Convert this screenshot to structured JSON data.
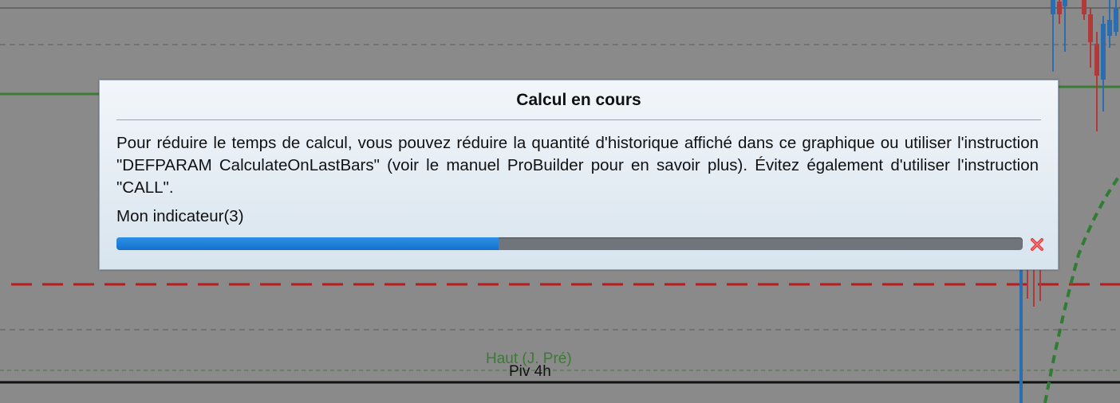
{
  "dialog": {
    "title": "Calcul en cours",
    "message": "Pour réduire le temps de calcul, vous pouvez réduire la quantité d'historique affiché dans ce graphique ou utiliser l'instruction \"DEFPARAM CalculateOnLastBars\" (voir le manuel ProBuilder pour en savoir plus). Évitez également d'utiliser l'instruction \"CALL\".",
    "indicator_label": "Mon indicateur(3)",
    "progress": 0.422,
    "progress_color": "#1e80dc",
    "cancel_icon": "close-x-icon",
    "cancel_color": "#e23d3d"
  },
  "chart": {
    "labels": {
      "haut": "Haut (J. Pré)",
      "piv": "Piv 4h"
    },
    "colors": {
      "background": "#8a8a8a",
      "support_line": "#b81c1c",
      "green_line": "#3c7a35",
      "bull_candle": "#2a6db0",
      "bear_candle": "#b03a3a"
    }
  }
}
